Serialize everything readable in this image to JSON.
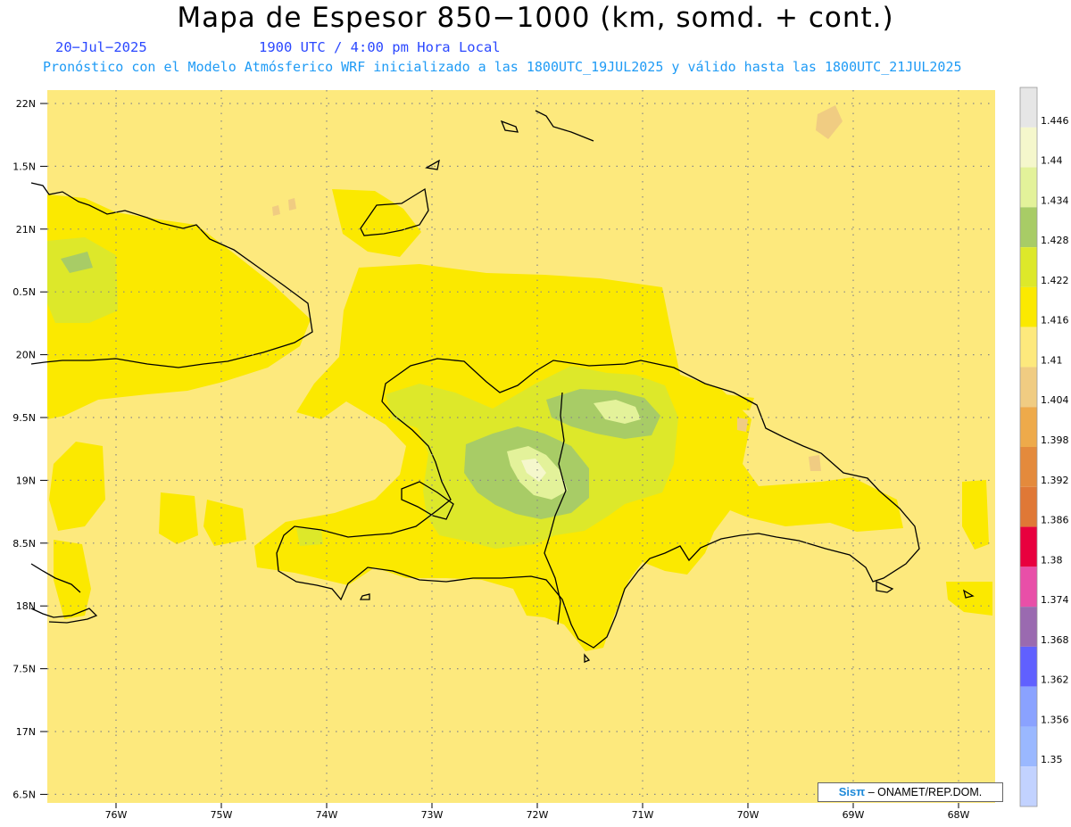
{
  "header": {
    "title": "Mapa de Espesor 850−1000 (km, somd. + cont.)",
    "date": "20−Jul−2025",
    "time": "1900 UTC / 4:00 pm Hora Local",
    "forecast": "Pronóstico con el Modelo Atmósferico WRF inicializado a las 1800UTC_19JUL2025 y válido hasta las  1800UTC_21JUL2025"
  },
  "map": {
    "lat_labels": [
      "22N",
      "1.5N",
      "21N",
      "0.5N",
      "20N",
      "9.5N",
      "19N",
      "8.5N",
      "18N",
      "7.5N",
      "17N",
      "6.5N"
    ],
    "lon_labels": [
      "76W",
      "75W",
      "74W",
      "73W",
      "72W",
      "71W",
      "70W",
      "69W",
      "68W"
    ]
  },
  "legend": {
    "labels": [
      "1.446",
      "1.44",
      "1.434",
      "1.428",
      "1.422",
      "1.416",
      "1.41",
      "1.404",
      "1.398",
      "1.392",
      "1.386",
      "1.38",
      "1.374",
      "1.368",
      "1.362",
      "1.356",
      "1.35"
    ],
    "colors": [
      "#e6e6e6",
      "#f5f7cc",
      "#e3f29a",
      "#a8cc66",
      "#dde82a",
      "#fbe900",
      "#fde97d",
      "#f0cc82",
      "#eeaa4a",
      "#e48a3c",
      "#e07836",
      "#e8003e",
      "#e84fa8",
      "#9a6ab0",
      "#6060ff",
      "#8aa2ff",
      "#9ab8ff",
      "#c2d2ff"
    ]
  },
  "credit": {
    "logo": "Sisπ",
    "text": "– ONAMET/REP.DOM."
  }
}
